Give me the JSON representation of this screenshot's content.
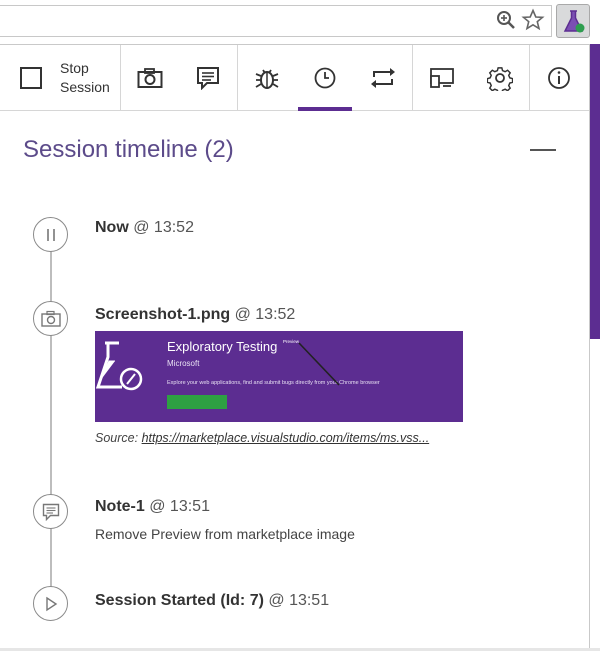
{
  "toolbar": {
    "stop_label": "Stop Session",
    "icons": [
      "stop-square-icon",
      "camera-icon",
      "note-icon",
      "bug-icon",
      "clock-icon",
      "repeat-icon",
      "devices-icon",
      "gear-icon",
      "info-icon"
    ],
    "active_tab": "clock-icon"
  },
  "timeline": {
    "title": "Session timeline (2)",
    "entries": [
      {
        "label": "Now",
        "time": "@ 13:52",
        "icon": "pause-icon"
      },
      {
        "label": "Screenshot-1.png",
        "time": "@ 13:52",
        "icon": "camera-icon",
        "thumbnail": {
          "title": "Exploratory Testing",
          "publisher": "Microsoft",
          "description": "Explore your web applications, find and submit bugs directly from your Chrome browser",
          "annotation": "Preview"
        },
        "source_prefix": "Source:",
        "source_url": "https://marketplace.visualstudio.com/items/ms.vss..."
      },
      {
        "label": "Note-1",
        "time": "@ 13:51",
        "icon": "note-icon",
        "note": "Remove Preview from marketplace image"
      },
      {
        "label": "Session Started (Id: 7)",
        "time": "@ 13:51",
        "icon": "play-icon"
      }
    ]
  },
  "colors": {
    "accent": "#5c2d91",
    "title": "#5c4b8a",
    "line": "#bdbdbd"
  }
}
